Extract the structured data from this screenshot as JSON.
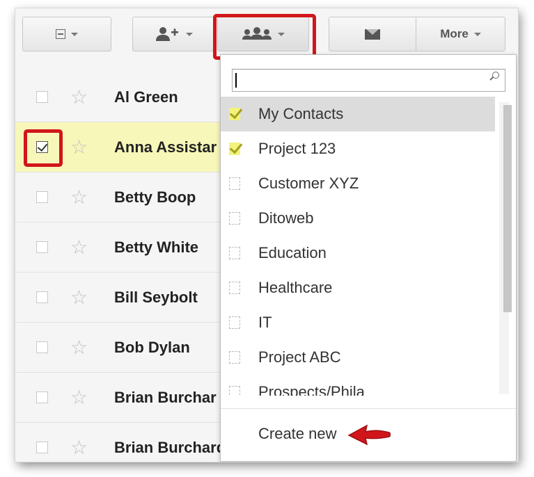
{
  "toolbar": {
    "select_icon": "select-all-checkbox-icon",
    "add_contact_icon": "add-person-icon",
    "groups_icon": "groups-icon",
    "email_icon": "envelope-icon",
    "more_label": "More"
  },
  "contacts": [
    {
      "name": "Al Green",
      "checked": false,
      "highlighted": false
    },
    {
      "name": "Anna Assistar",
      "checked": true,
      "highlighted": true
    },
    {
      "name": "Betty Boop",
      "checked": false,
      "highlighted": false
    },
    {
      "name": "Betty White",
      "checked": false,
      "highlighted": false
    },
    {
      "name": "Bill Seybolt",
      "checked": false,
      "highlighted": false
    },
    {
      "name": "Bob Dylan",
      "checked": false,
      "highlighted": false
    },
    {
      "name": "Brian Burchar",
      "checked": false,
      "highlighted": false
    },
    {
      "name": "Brian Burchard",
      "checked": false,
      "highlighted": false
    }
  ],
  "groups_menu": {
    "search_placeholder": "",
    "labels": [
      {
        "label": "My Contacts",
        "checked": true,
        "selected": true
      },
      {
        "label": "Project 123",
        "checked": true,
        "selected": false
      },
      {
        "label": "Customer XYZ",
        "checked": false,
        "selected": false
      },
      {
        "label": "Ditoweb",
        "checked": false,
        "selected": false
      },
      {
        "label": "Education",
        "checked": false,
        "selected": false
      },
      {
        "label": "Healthcare",
        "checked": false,
        "selected": false
      },
      {
        "label": "IT",
        "checked": false,
        "selected": false
      },
      {
        "label": "Project ABC",
        "checked": false,
        "selected": false
      },
      {
        "label": "Prospects/Phila",
        "checked": false,
        "selected": false
      }
    ],
    "create_new": "Create new"
  },
  "colors": {
    "highlight_row": "#f7f7b9",
    "annotation_red": "#d1161b",
    "check_yellow": "#f3f27c"
  }
}
